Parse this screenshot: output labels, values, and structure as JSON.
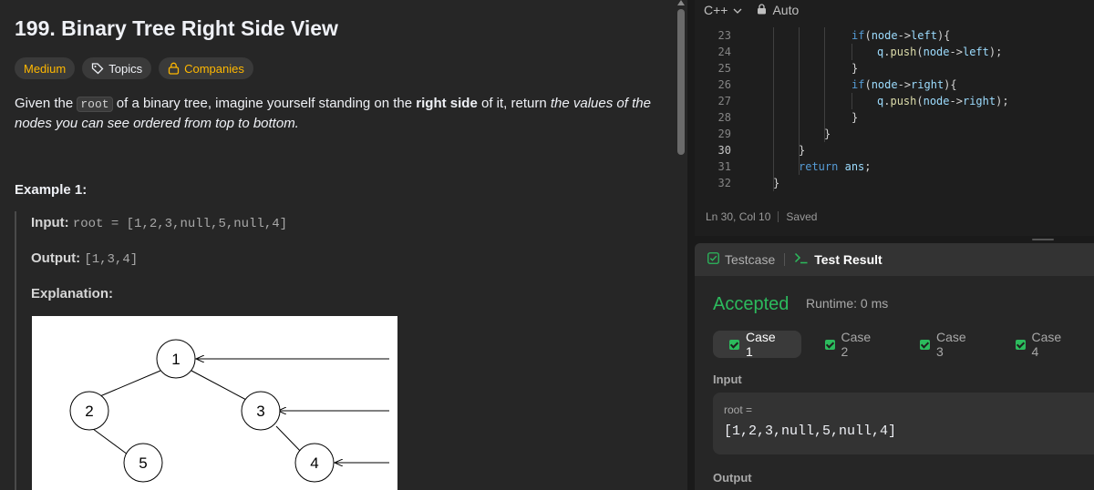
{
  "problem": {
    "title": "199. Binary Tree Right Side View",
    "difficulty": "Medium",
    "topics_label": "Topics",
    "companies_label": "Companies",
    "desc_part1": "Given the ",
    "desc_code": "root",
    "desc_part2": " of a binary tree, imagine yourself standing on the ",
    "desc_bold": "right side",
    "desc_part3": " of it, return ",
    "desc_italic": "the values of the nodes you can see ordered from top to bottom.",
    "example_title": "Example 1:",
    "example_input_label": "Input:",
    "example_input_value": "root = [1,2,3,null,5,null,4]",
    "example_output_label": "Output:",
    "example_output_value": "[1,3,4]",
    "example_explanation_label": "Explanation:",
    "tree_nodes": [
      "1",
      "2",
      "3",
      "5",
      "4"
    ]
  },
  "editor": {
    "language": "C++",
    "mode": "Auto",
    "lines": [
      {
        "num": "23",
        "text": "if(node->left){"
      },
      {
        "num": "24",
        "text": "q.push(node->left);"
      },
      {
        "num": "25",
        "text": "}"
      },
      {
        "num": "26",
        "text": "if(node->right){"
      },
      {
        "num": "27",
        "text": "q.push(node->right);"
      },
      {
        "num": "28",
        "text": "}"
      },
      {
        "num": "29",
        "text": "}"
      },
      {
        "num": "30",
        "text": "}"
      },
      {
        "num": "31",
        "text": "return ans;"
      },
      {
        "num": "32",
        "text": "}"
      }
    ],
    "cursor_position": "Ln 30, Col 10",
    "save_status": "Saved"
  },
  "result": {
    "tab_testcase": "Testcase",
    "tab_result": "Test Result",
    "status": "Accepted",
    "runtime": "Runtime: 0 ms",
    "cases": [
      "Case 1",
      "Case 2",
      "Case 3",
      "Case 4"
    ],
    "input_label": "Input",
    "input_var": "root =",
    "input_value": "[1,2,3,null,5,null,4]",
    "output_label": "Output"
  },
  "colors": {
    "accepted": "#2cbb5d",
    "medium": "#ffb800",
    "keyword": "#569cd6"
  }
}
